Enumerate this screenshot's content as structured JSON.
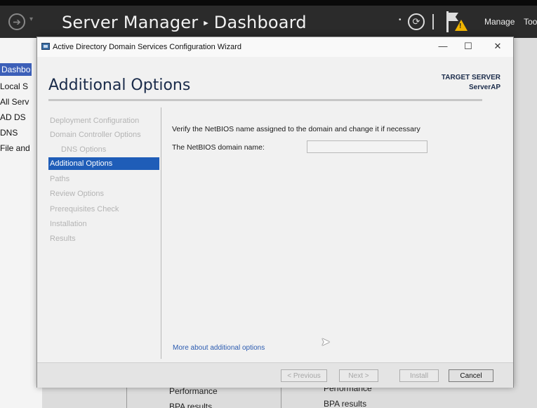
{
  "server_manager": {
    "title": "Server Manager",
    "breadcrumb_sep": "▸",
    "section": "Dashboard",
    "manage_label": "Manage",
    "tools_label": "Too",
    "nav": [
      "Dashbo",
      "Local S",
      "All Serv",
      "AD DS",
      "DNS",
      "File and"
    ],
    "tiles": {
      "col1": [
        "Performance",
        "BPA results"
      ],
      "col2": [
        "Performance",
        "BPA results"
      ]
    }
  },
  "wizard": {
    "window_title": "Active Directory Domain Services Configuration Wizard",
    "controls": {
      "minimize": "—",
      "maximize": "☐",
      "close": "✕"
    },
    "heading": "Additional Options",
    "target_label": "TARGET SERVER",
    "target_name": "ServerAP",
    "steps": [
      {
        "label": "Deployment Configuration"
      },
      {
        "label": "Domain Controller Options"
      },
      {
        "label": "DNS Options"
      },
      {
        "label": "Additional Options"
      },
      {
        "label": "Paths"
      },
      {
        "label": "Review Options"
      },
      {
        "label": "Prerequisites Check"
      },
      {
        "label": "Installation"
      },
      {
        "label": "Results"
      }
    ],
    "instruction": "Verify the NetBIOS name assigned to the domain and change it if necessary",
    "netbios_label": "The NetBIOS domain name:",
    "netbios_value": "",
    "more_link": "More about additional options",
    "buttons": {
      "previous": "< Previous",
      "next": "Next >",
      "install": "Install",
      "cancel": "Cancel"
    }
  },
  "colors": {
    "accent": "#1f5db8",
    "header_bg": "#2b2b2b",
    "link": "#2b5bb0",
    "warning": "#f0b400"
  }
}
